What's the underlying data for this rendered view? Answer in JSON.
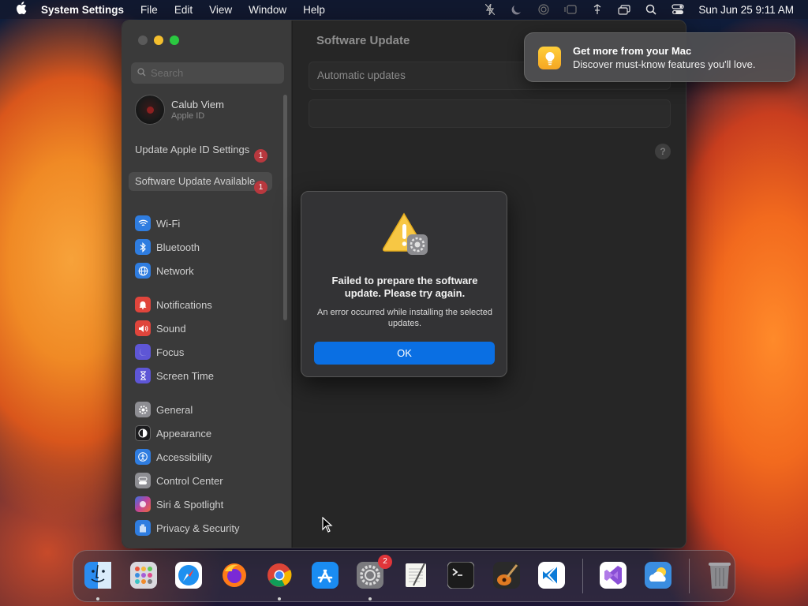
{
  "menubar": {
    "app_name": "System Settings",
    "menus": [
      "File",
      "Edit",
      "View",
      "Window",
      "Help"
    ],
    "clock": "Sun Jun 25  9:11 AM"
  },
  "window": {
    "search_placeholder": "Search",
    "account": {
      "name": "Calub Viem",
      "subtitle": "Apple ID"
    },
    "notices": [
      {
        "label": "Update Apple ID Settings",
        "badge": "1"
      },
      {
        "label": "Software Update Available",
        "badge": "1"
      }
    ],
    "nav_groups": [
      [
        {
          "label": "Wi-Fi",
          "icon": "wifi-icon",
          "color": "#2f7de0"
        },
        {
          "label": "Bluetooth",
          "icon": "bluetooth-icon",
          "color": "#2f7de0"
        },
        {
          "label": "Network",
          "icon": "globe-icon",
          "color": "#2f7de0"
        }
      ],
      [
        {
          "label": "Notifications",
          "icon": "bell-icon",
          "color": "#e0453c"
        },
        {
          "label": "Sound",
          "icon": "speaker-icon",
          "color": "#e0453c"
        },
        {
          "label": "Focus",
          "icon": "moon-icon",
          "color": "#5e56d6"
        },
        {
          "label": "Screen Time",
          "icon": "hourglass-icon",
          "color": "#5e56d6"
        }
      ],
      [
        {
          "label": "General",
          "icon": "gear-icon",
          "color": "#8e8e93"
        },
        {
          "label": "Appearance",
          "icon": "appearance-icon",
          "color": "#1c1c1e"
        },
        {
          "label": "Accessibility",
          "icon": "accessibility-icon",
          "color": "#2f7de0"
        },
        {
          "label": "Control Center",
          "icon": "control-center-icon",
          "color": "#8e8e93"
        },
        {
          "label": "Siri & Spotlight",
          "icon": "siri-icon",
          "color": "#c1449b"
        },
        {
          "label": "Privacy & Security",
          "icon": "hand-icon",
          "color": "#2f7de0"
        }
      ]
    ],
    "content": {
      "title": "Software Update",
      "automatic_updates": "Automatic updates",
      "help": "?"
    }
  },
  "notification": {
    "title": "Get more from your Mac",
    "body": "Discover must-know features you'll love."
  },
  "alert": {
    "title": "Failed to prepare the software update. Please try again.",
    "message": "An error occurred while installing the selected updates.",
    "ok_label": "OK"
  },
  "dock": {
    "apps": [
      {
        "name": "Finder",
        "icon": "finder-icon",
        "color": "#2a8cf0",
        "running": true
      },
      {
        "name": "Launchpad",
        "icon": "launchpad-icon",
        "color": "#d9d9de",
        "running": false
      },
      {
        "name": "Safari",
        "icon": "safari-icon",
        "color": "#1e90f0",
        "running": false
      },
      {
        "name": "Firefox",
        "icon": "firefox-icon",
        "color": "#ff7a18",
        "running": false
      },
      {
        "name": "Chrome",
        "icon": "chrome-icon",
        "color": "#ffffff",
        "running": true
      },
      {
        "name": "App Store",
        "icon": "app-store-icon",
        "color": "#1a8cf2",
        "running": false
      },
      {
        "name": "System Settings",
        "icon": "system-settings-icon",
        "color": "#7a7a7e",
        "running": true,
        "badge": "2"
      },
      {
        "name": "TextEdit",
        "icon": "textedit-icon",
        "color": "#f2f2f2",
        "running": false
      },
      {
        "name": "Terminal",
        "icon": "terminal-icon",
        "color": "#1b1b1b",
        "running": false
      },
      {
        "name": "GarageBand",
        "icon": "garageband-icon",
        "color": "#e07a22",
        "running": false
      },
      {
        "name": "Visual Studio Code",
        "icon": "vscode-icon",
        "color": "#ffffff",
        "running": false
      },
      {
        "name": "Visual Studio",
        "icon": "visual-studio-icon",
        "color": "#ffffff",
        "running": false
      },
      {
        "name": "Weather",
        "icon": "weather-icon",
        "color": "#3a8de0",
        "running": false
      },
      {
        "name": "Trash",
        "icon": "trash-icon",
        "color": "#5a5a5e",
        "running": false
      }
    ]
  }
}
